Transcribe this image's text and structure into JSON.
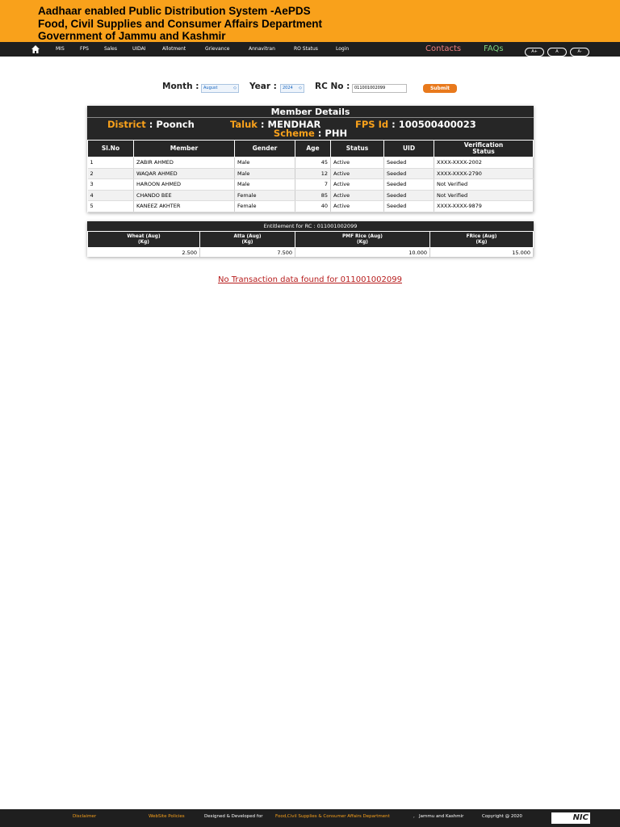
{
  "header": {
    "line1": "Aadhaar enabled Public Distribution System -AePDS",
    "line2": "Food, Civil Supplies and Consumer Affairs Department",
    "line3": "Government of Jammu and Kashmir"
  },
  "nav": {
    "items": [
      "MIS",
      "FPS",
      "Sales",
      "UIDAI",
      "Allotment",
      "Grievance",
      "Annavitran",
      "RO Status",
      "Login"
    ],
    "contacts": "Contacts",
    "faqs": "FAQs",
    "font_buttons": [
      "A+",
      "A",
      "A-"
    ]
  },
  "form": {
    "month_label": "Month :",
    "month_value": "August",
    "year_label": "Year :",
    "year_value": "2024",
    "rc_label": "RC No :",
    "rc_value": "011001002099",
    "submit_label": "Submit"
  },
  "member_details": {
    "title": "Member Details",
    "district_label": "District",
    "district_value": "Poonch",
    "taluk_label": "Taluk",
    "taluk_value": "MENDHAR",
    "fps_label": "FPS Id",
    "fps_value": "100500400023",
    "scheme_label": "Scheme",
    "scheme_value": "PHH",
    "columns": [
      "Sl.No",
      "Member",
      "Gender",
      "Age",
      "Status",
      "UID",
      "Verification Status"
    ],
    "rows": [
      [
        "1",
        "ZABIR AHMED",
        "Male",
        "45",
        "Active",
        "Seeded",
        "XXXX-XXXX-2002"
      ],
      [
        "2",
        "WAQAR AHMED",
        "Male",
        "12",
        "Active",
        "Seeded",
        "XXXX-XXXX-2790"
      ],
      [
        "3",
        "HAROON AHMED",
        "Male",
        "7",
        "Active",
        "Seeded",
        "Not Verified"
      ],
      [
        "4",
        "CHANDO BEE",
        "Female",
        "85",
        "Active",
        "Seeded",
        "Not Verified"
      ],
      [
        "5",
        "KANEEZ AKHTER",
        "Female",
        "40",
        "Active",
        "Seeded",
        "XXXX-XXXX-9879"
      ]
    ]
  },
  "entitlement": {
    "title": "Entitlement for RC : 011001002099",
    "columns": [
      "Wheat (Aug) (Kg)",
      "Atta (Aug) (Kg)",
      "PMF Rice (Aug) (Kg)",
      "FRice (Aug) (Kg)"
    ],
    "column_lines": [
      [
        "Wheat (Aug)",
        "(Kg)"
      ],
      [
        "Atta (Aug)",
        "(Kg)"
      ],
      [
        "PMF Rice (Aug)",
        "(Kg)"
      ],
      [
        "FRice (Aug)",
        "(Kg)"
      ]
    ],
    "values": [
      "2.500",
      "7.500",
      "10.000",
      "15.000"
    ]
  },
  "no_transaction": "No Transaction data found for 011001002099",
  "footer": {
    "disclaimer": "Disclaimer",
    "policies": "WebSite Policies",
    "designed": "Designed & Developed for",
    "dept": "Food,Civil Supplies & Consumer Affairs Department",
    "comma": ",",
    "state": "Jammu and Kashmir",
    "copyright": "Copyright @ 2020",
    "logo": "NIC"
  },
  "colors": {
    "header_bg": "#f9a11b",
    "nav_bg": "#1f1f1f",
    "accent_orange": "#f9a11b",
    "submit_bg": "#e8791c",
    "link_red": "#b71c1c"
  }
}
